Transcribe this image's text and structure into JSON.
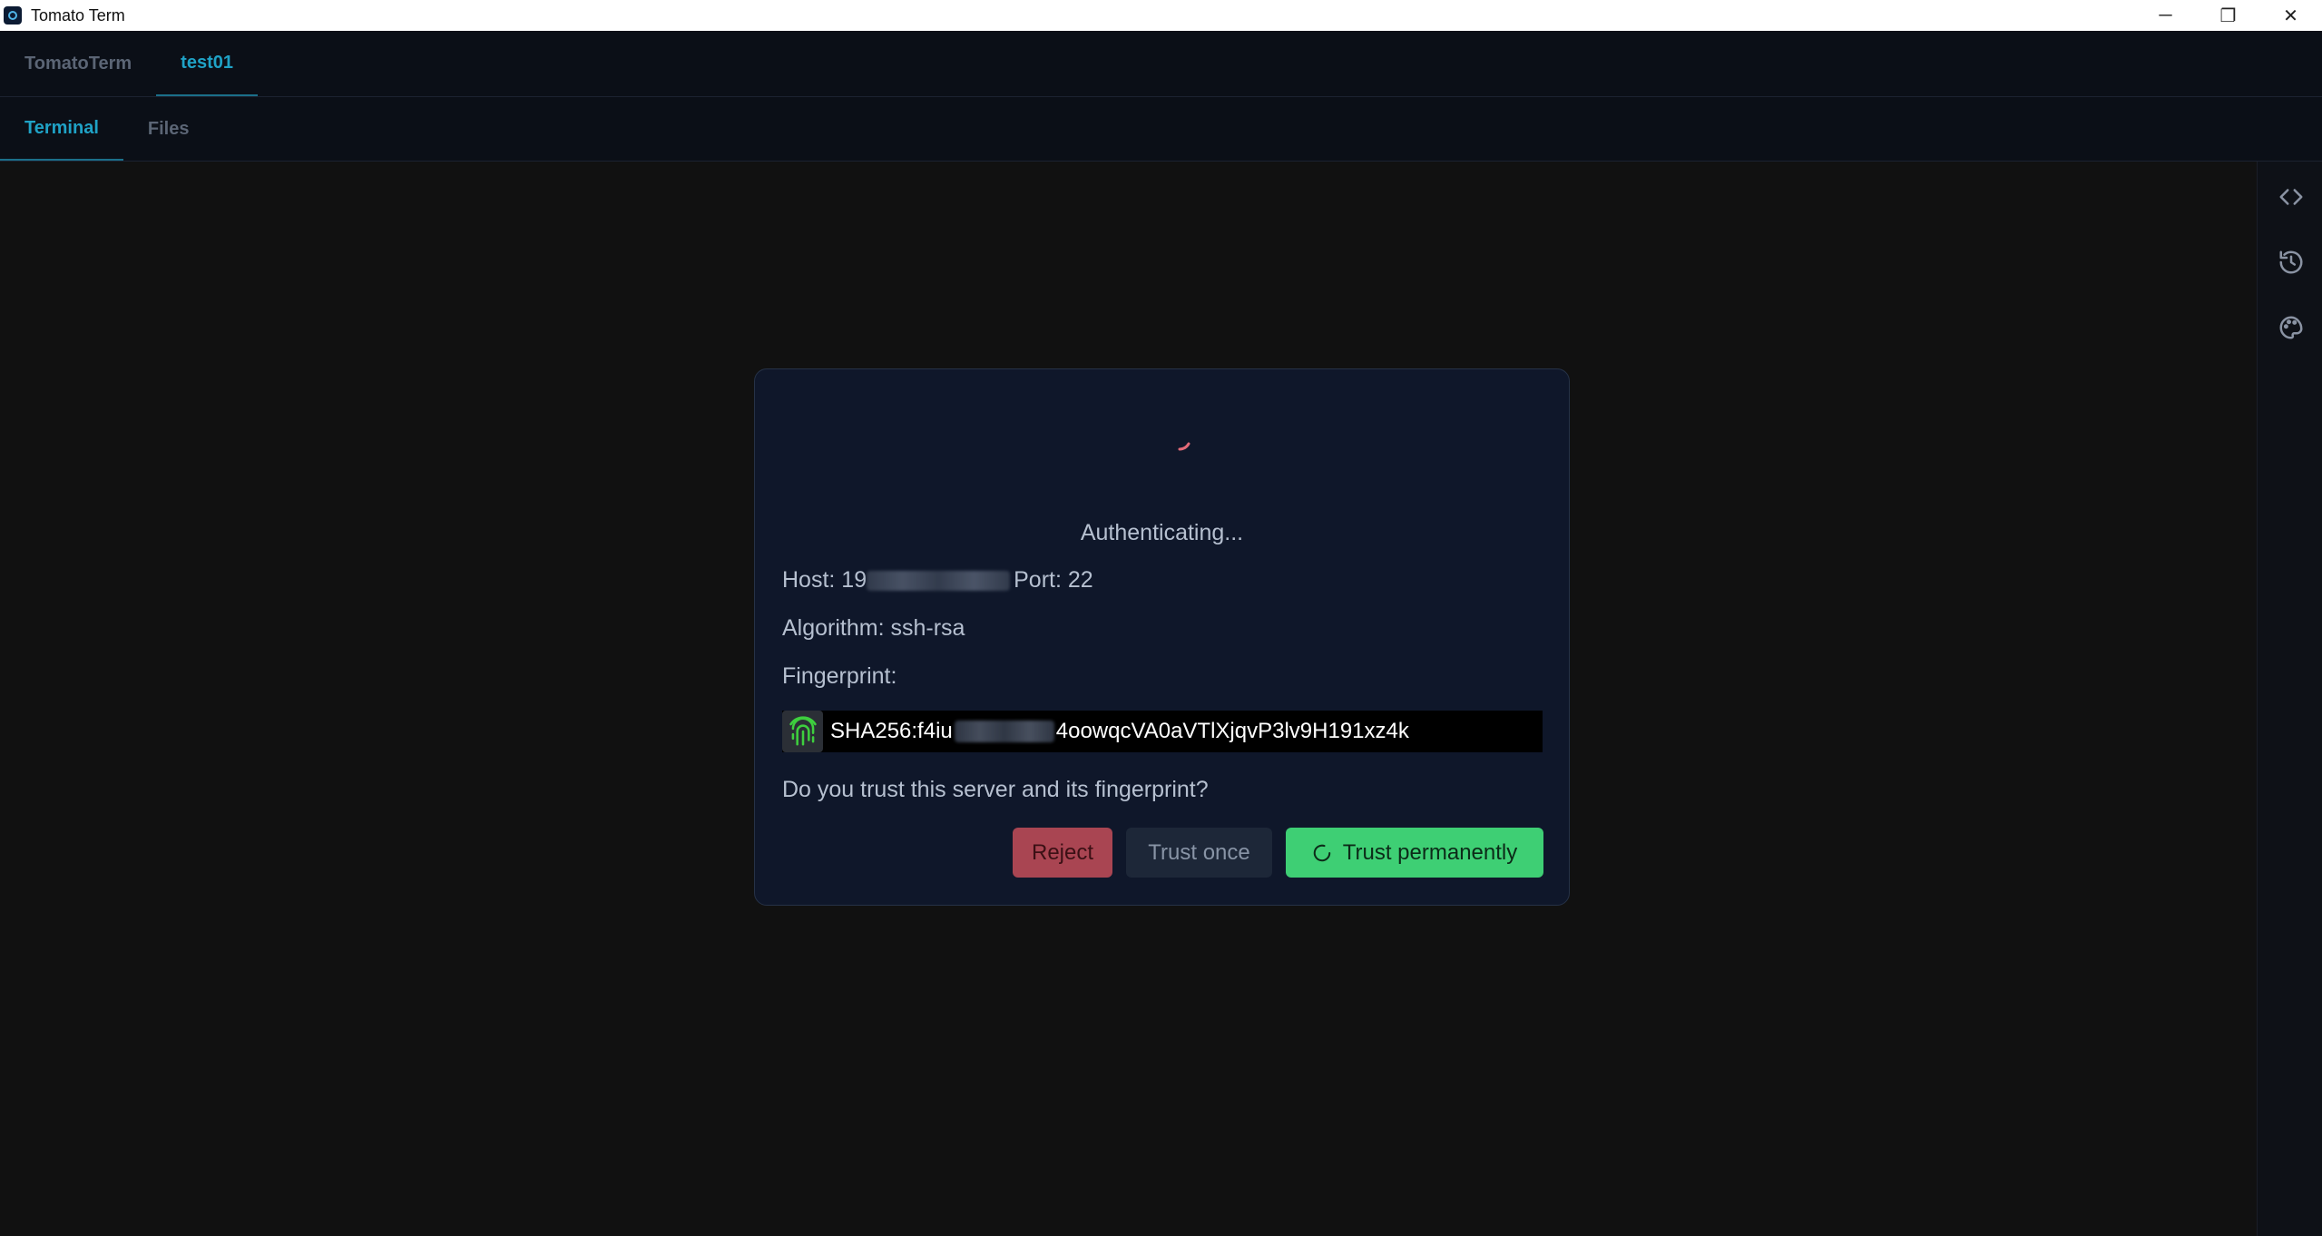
{
  "window": {
    "title": "Tomato Term",
    "minimize_glyph": "─",
    "maximize_glyph": "❐",
    "close_glyph": "✕"
  },
  "top_tabs": [
    {
      "label": "TomatoTerm",
      "active": false
    },
    {
      "label": "test01",
      "active": true
    }
  ],
  "sub_tabs": [
    {
      "label": "Terminal",
      "active": true
    },
    {
      "label": "Files",
      "active": false
    }
  ],
  "right_rail": {
    "icons": [
      "code-icon",
      "history-icon",
      "palette-icon"
    ]
  },
  "dialog": {
    "status": "Authenticating...",
    "host_label": "Host: 19",
    "port_label": "Port: 22",
    "algorithm_label": "Algorithm: ssh-rsa",
    "fingerprint_label": "Fingerprint:",
    "fingerprint_prefix": "SHA256:f4iu",
    "fingerprint_suffix": "4oowqcVA0aVTlXjqvP3lv9H191xz4k",
    "question": "Do you trust this server and its fingerprint?",
    "buttons": {
      "reject": "Reject",
      "trust_once": "Trust once",
      "trust_permanently": "Trust permanently"
    }
  },
  "colors": {
    "accent": "#1fa2c6",
    "dialog_bg": "#0f172a",
    "reject": "#a94552",
    "trust_permanently": "#3ecf74",
    "spinner": "#e26a78"
  }
}
